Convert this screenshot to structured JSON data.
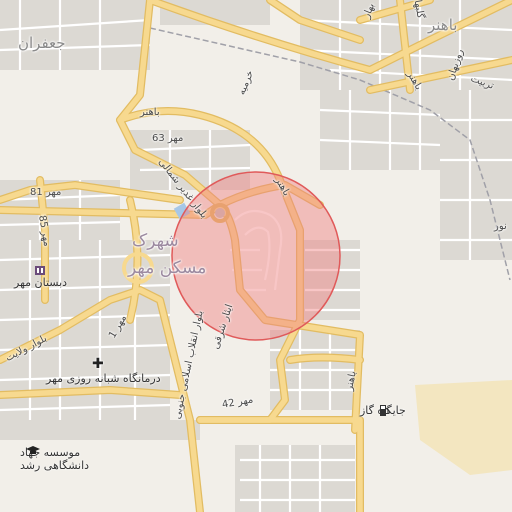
{
  "map": {
    "colors": {
      "background": "#f2efe9",
      "major_road": "#f7d98f",
      "major_road_casing": "#e2bc62",
      "minor_road": "#ffffff",
      "block": "#d9d6d0",
      "highlight_fill": "#f08080",
      "highlight_stroke": "#e05a5a",
      "industrial": "#f3e6c0",
      "park": "#d2ecd2",
      "railway": "#a0a0a8"
    },
    "labels": {
      "jafaran": "جعفران",
      "baher_top": "باهنر",
      "baher_road_top": "باهنر",
      "baher_left": "باهنر",
      "mehr_63": "مهر 63",
      "boulevard_ghadir": "بلوار غدیر شمالی",
      "shahrak": "شهرک",
      "maskan_mehr": "مسکن مهر",
      "mehr_81": "مهر 81",
      "mehr_85": "مهر 85",
      "boulevard_velayat": "بلوار ولایت",
      "mehr_1": "مهر 1",
      "boulevard_enghelab": "بلوار انقلاب اسلامی جنوبی",
      "eythar_sharghi": "ایثار شرقی",
      "mehr_42": "مهر 42",
      "baher_right": "باهنر",
      "baher_east": "باهنر",
      "sarv": "بهار",
      "nour": "نور",
      "rozbahan": "روزبهان",
      "golbahar": "گلبهار",
      "tarbiat": "تربیت",
      "khorramieh": "خرمیه"
    },
    "pois": {
      "school_name": "دبستان مهر",
      "clinic_name": "درمانگاه شبانه روزی مهر",
      "gas_station": "جایگاه گاز",
      "institute_line1": "موسسه جهاد",
      "institute_line2": "دانشگاهی رشد"
    },
    "icons": {
      "school": "school-icon",
      "clinic": "hospital-cross-icon",
      "fuel": "fuel-pump-icon",
      "institute": "graduation-cap-icon"
    }
  }
}
